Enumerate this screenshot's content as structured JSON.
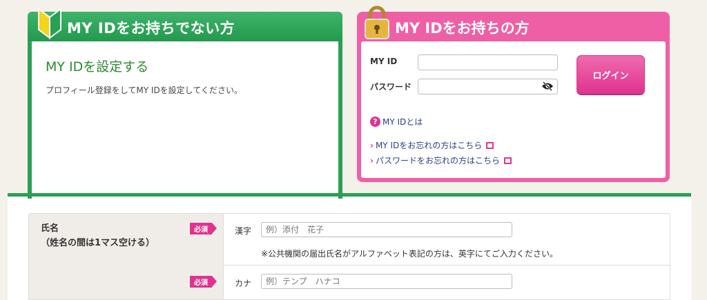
{
  "left_panel": {
    "title": "MY IDをお持ちでない方",
    "heading": "MY IDを設定する",
    "description": "プロフィール登録をしてMY IDを設定してください。"
  },
  "right_panel": {
    "title": "MY IDをお持ちの方",
    "myid_label": "MY ID",
    "myid_value": "",
    "password_label": "パスワード",
    "password_value": "",
    "login_label": "ログイン",
    "help_link": "MY IDとは",
    "forgot_id_link": "MY IDをお忘れの方はこちら",
    "forgot_password_link": "パスワードをお忘れの方はこちら"
  },
  "form": {
    "name_label": "氏名",
    "name_sublabel": "（姓名の間は1マス空ける）",
    "required_badge": "必須",
    "kanji_label": "漢字",
    "kanji_placeholder": "例）添付　花子",
    "kanji_note": "※公共機関の届出氏名がアルファベット表記の方は、英字にてご入力ください。",
    "kana_label": "カナ",
    "kana_placeholder": "例）テンプ　ハナコ"
  },
  "colors": {
    "green": "#2aa055",
    "pink": "#ee5fa6",
    "link_blue": "#2a3f8a"
  }
}
